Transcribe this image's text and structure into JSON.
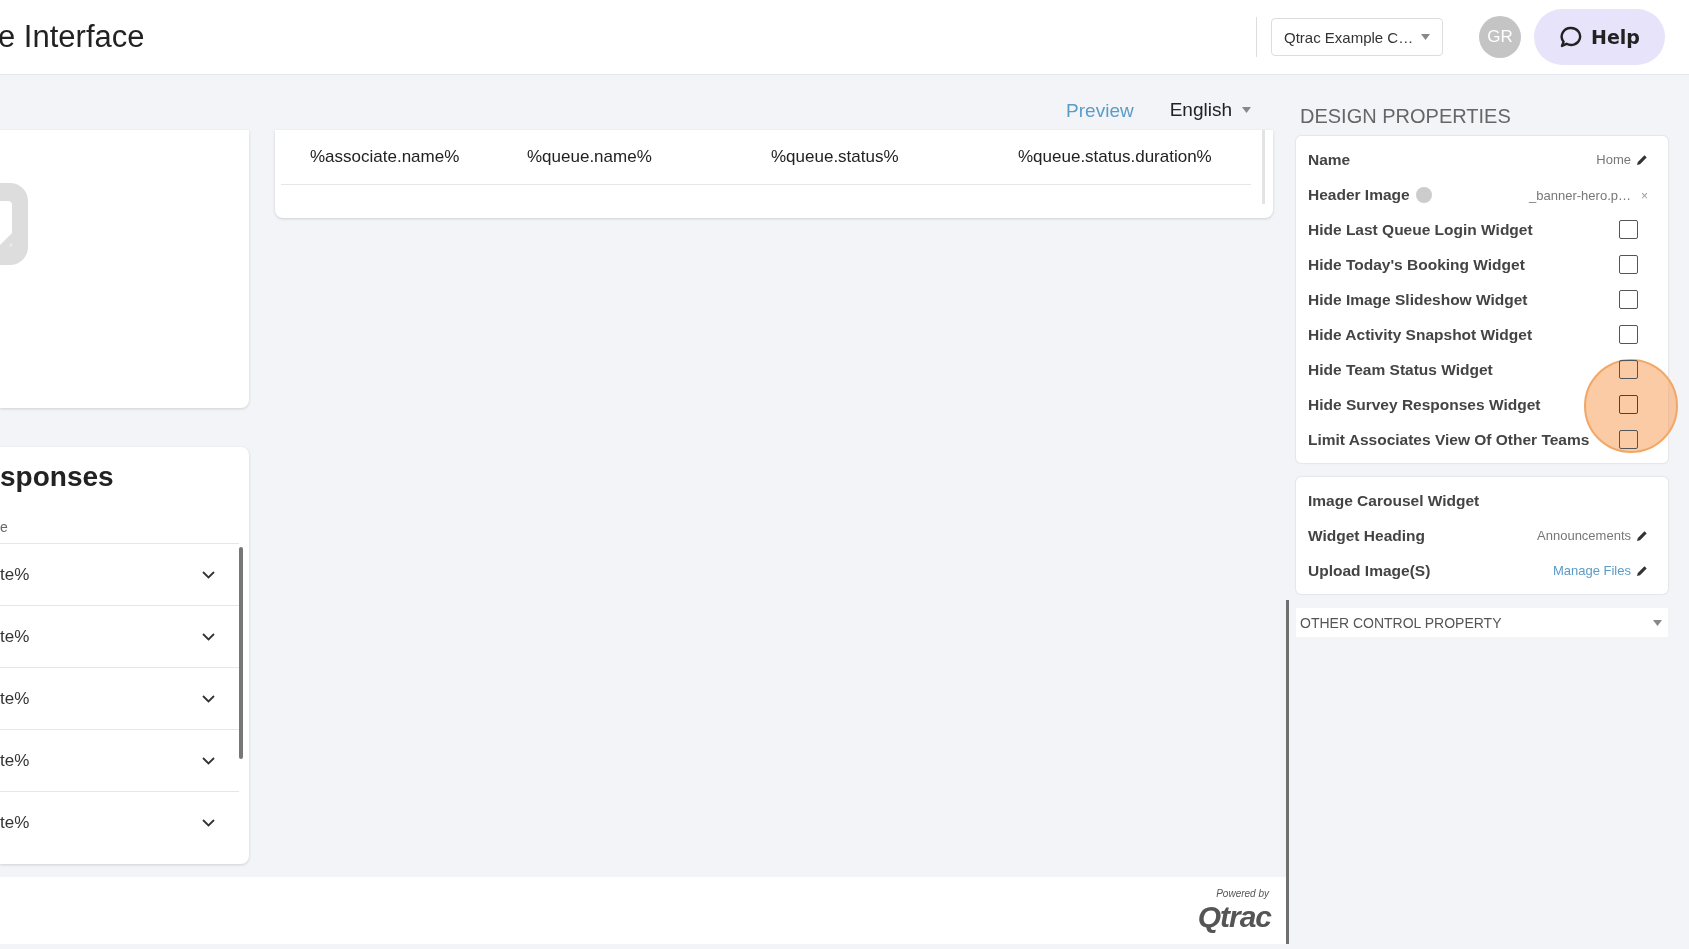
{
  "header": {
    "title": "e Interface",
    "company": "Qtrac Example C…",
    "avatar": "GR",
    "help": "Help"
  },
  "toolbar": {
    "preview": "Preview",
    "language": "English"
  },
  "team_table": {
    "cells": [
      "%associate.name%",
      "%queue.name%",
      "%queue.status%",
      "%queue.status.duration%"
    ]
  },
  "survey_card": {
    "title": "sponses",
    "subtitle": "e",
    "rows": [
      {
        "text": "te%",
        "expanded": false
      },
      {
        "text": "te%",
        "expanded": false
      },
      {
        "text": "te%",
        "expanded": false
      },
      {
        "text": "te%",
        "expanded": false
      },
      {
        "text": "te%",
        "expanded": false
      }
    ]
  },
  "footer": {
    "powered_by": "Powered by",
    "brand": "Qtrac"
  },
  "design_properties": {
    "title": "DESIGN PROPERTIES",
    "name": {
      "label": "Name",
      "value": "Home"
    },
    "header_image": {
      "label": "Header Image",
      "value": "_banner-hero.p…",
      "remove": "×"
    },
    "options": [
      {
        "label": "Hide Last Queue Login Widget",
        "checked": false,
        "highlighted": false
      },
      {
        "label": "Hide Today's Booking Widget",
        "checked": false,
        "highlighted": false
      },
      {
        "label": "Hide Image Slideshow Widget",
        "checked": false,
        "highlighted": false
      },
      {
        "label": "Hide Activity Snapshot Widget",
        "checked": false,
        "highlighted": false
      },
      {
        "label": "Hide Team Status Widget",
        "checked": false,
        "highlighted": false
      },
      {
        "label": "Hide Survey Responses Widget",
        "checked": false,
        "highlighted": true
      },
      {
        "label": "Limit Associates View Of Other Teams",
        "checked": false,
        "highlighted": false
      }
    ],
    "carousel": {
      "title": "Image Carousel Widget",
      "heading_label": "Widget Heading",
      "heading_value": "Announcements",
      "upload_label": "Upload Image(S)",
      "upload_link": "Manage Files"
    },
    "other": {
      "label": "OTHER CONTROL PROPERTY",
      "expanded": false
    }
  }
}
